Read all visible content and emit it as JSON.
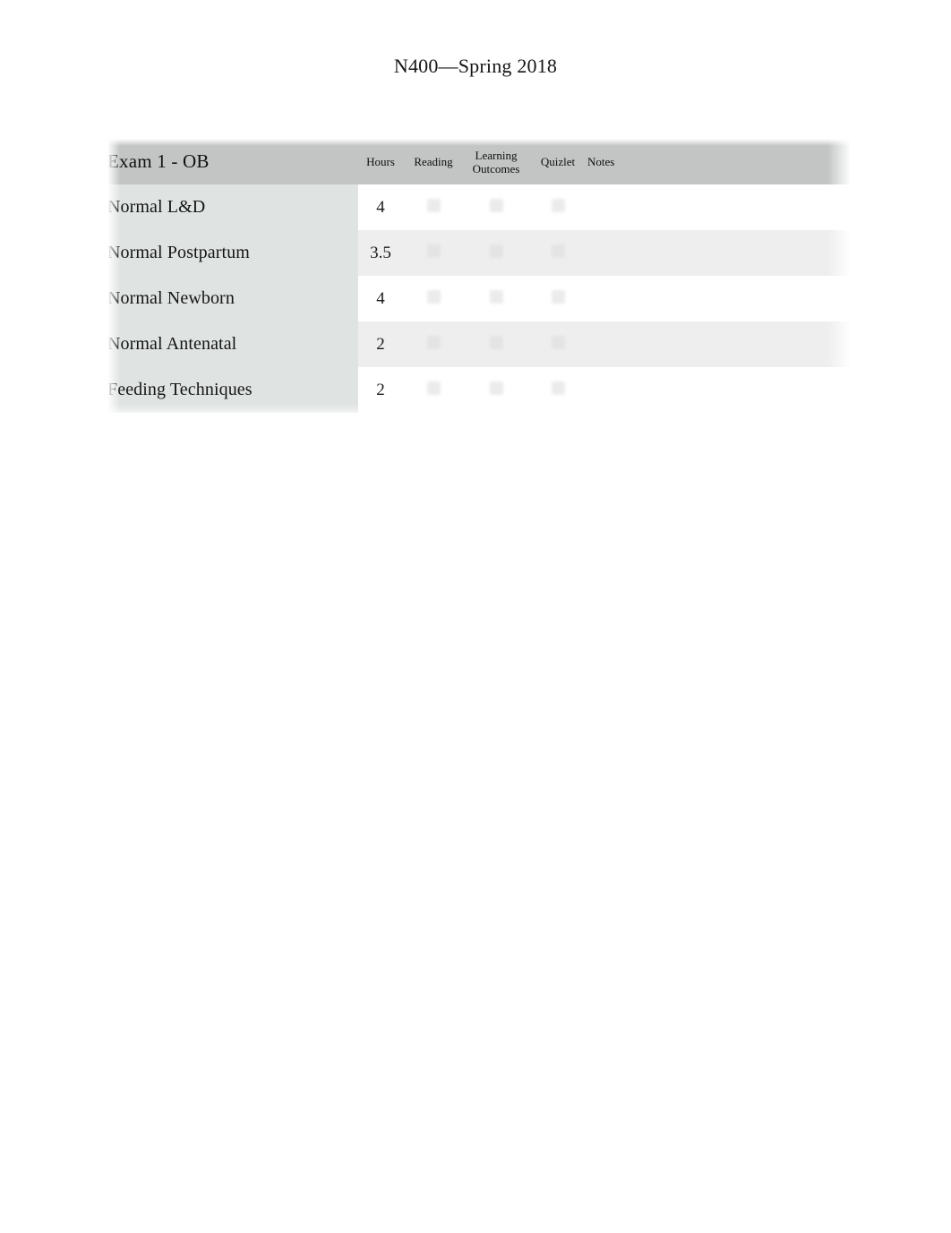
{
  "document": {
    "title": "N400—Spring 2018"
  },
  "table": {
    "header": {
      "topic": "Exam 1 - OB",
      "hours": "Hours",
      "reading": "Reading",
      "learning_outcomes_line1": "Learning",
      "learning_outcomes_line2": "Outcomes",
      "quizlet": "Quizlet",
      "notes": "Notes"
    },
    "rows": [
      {
        "topic": "Normal L&D",
        "hours": "4",
        "reading": "",
        "learning_outcomes": "",
        "quizlet": "",
        "notes": ""
      },
      {
        "topic": "Normal Postpartum",
        "hours": "3.5",
        "reading": "",
        "learning_outcomes": "",
        "quizlet": "",
        "notes": ""
      },
      {
        "topic": "Normal Newborn",
        "hours": "4",
        "reading": "",
        "learning_outcomes": "",
        "quizlet": "",
        "notes": ""
      },
      {
        "topic": "Normal Antenatal",
        "hours": "2",
        "reading": "",
        "learning_outcomes": "",
        "quizlet": "",
        "notes": ""
      },
      {
        "topic": "Feeding Techniques",
        "hours": "2",
        "reading": "",
        "learning_outcomes": "",
        "quizlet": "",
        "notes": ""
      }
    ]
  },
  "colors": {
    "header_band": "#c2c5c4",
    "topic_column": "#dfe3e2",
    "row_stripe": "#eeeeee",
    "page_background": "#ffffff",
    "text": "#151515"
  }
}
